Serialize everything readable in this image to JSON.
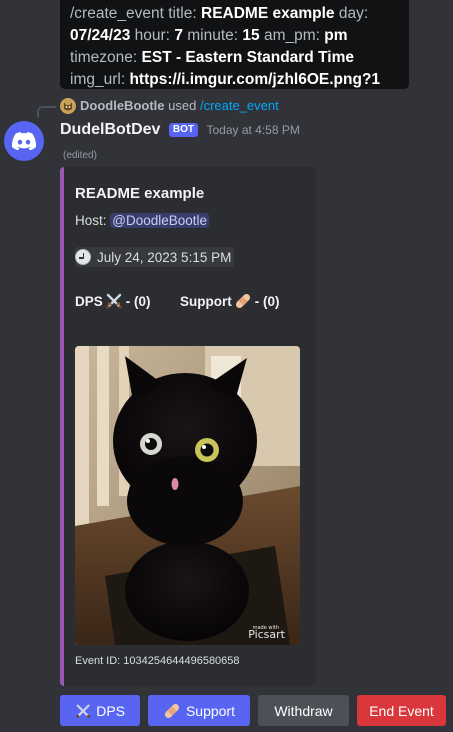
{
  "tooltip": {
    "command": "/create_event",
    "title_key": "title:",
    "title_val": "README example",
    "day_key": "day:",
    "day_val": "07/24/23",
    "hour_key": "hour:",
    "hour_val": "7",
    "minute_key": "minute:",
    "minute_val": "15",
    "ampm_key": "am_pm:",
    "ampm_val": "pm",
    "tz_key": "timezone:",
    "tz_val": "EST - Eastern Standard Time",
    "img_key": "img_url:",
    "img_val": "https://i.imgur.com/jzhl6OE.png?1"
  },
  "reply": {
    "username": "DoodleBootle",
    "used_text": "used",
    "command": "/create_event"
  },
  "message": {
    "username": "DudelBotDev",
    "bot_tag": "BOT",
    "timestamp": "Today at 4:58 PM",
    "edited": "(edited)"
  },
  "embed": {
    "title": "README example",
    "host_label": "Host:",
    "host_mention": "@DoodleBootle",
    "date": "July 24, 2023 5:15 PM",
    "dps_label": "DPS",
    "dps_count": "- (0)",
    "support_label": "Support",
    "support_count": "- (0)",
    "image_watermark_small": "made with",
    "image_watermark": "Picsart",
    "footer": "Event ID: 1034254644496580658",
    "accent_color": "#9b59b6"
  },
  "buttons": {
    "dps": "DPS",
    "support": "Support",
    "withdraw": "Withdraw",
    "end_event": "End Event"
  },
  "colors": {
    "background": "#313338",
    "blurple": "#5865f2",
    "grey_button": "#4e5058",
    "danger": "#da373c",
    "link": "#00a8fc"
  }
}
